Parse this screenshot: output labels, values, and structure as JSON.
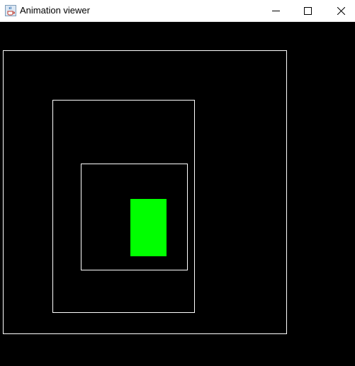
{
  "window": {
    "title": "Animation viewer",
    "icon": "java-cup-icon",
    "controls": {
      "minimize_icon": "minimize-icon",
      "maximize_icon": "maximize-icon",
      "close_icon": "close-icon"
    }
  },
  "canvas": {
    "background_color": "#000000",
    "frame_color": "#ffffff",
    "sprite_color": "#00ff00"
  }
}
